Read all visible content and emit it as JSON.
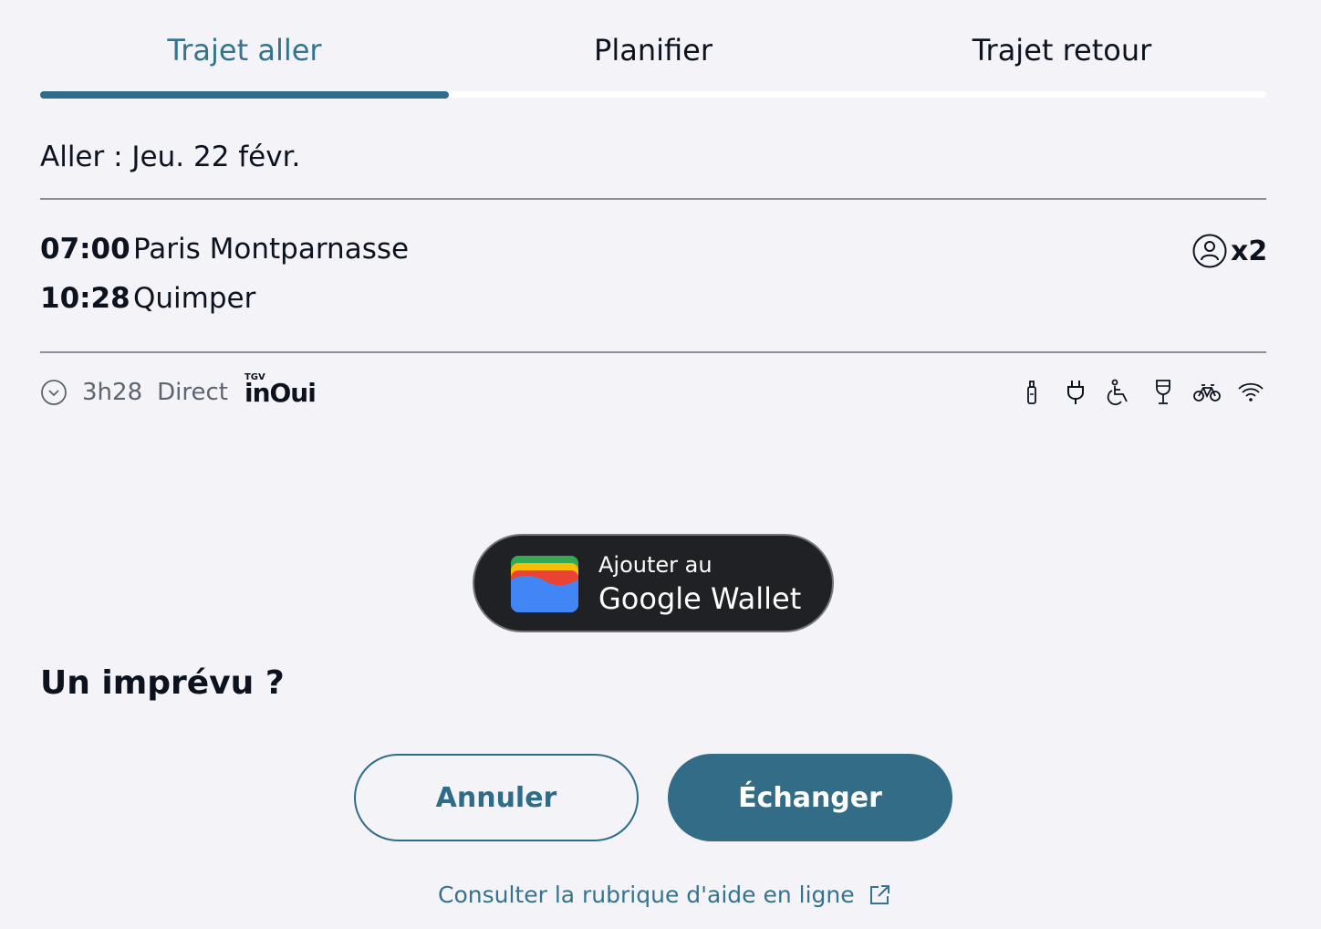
{
  "tabs": [
    {
      "label": "Trajet aller",
      "active": true
    },
    {
      "label": "Planifier",
      "active": false
    },
    {
      "label": "Trajet retour",
      "active": false
    }
  ],
  "outbound": {
    "date_label": "Aller : Jeu. 22 févr.",
    "departure": {
      "time": "07:00",
      "station": "Paris Montparnasse"
    },
    "arrival": {
      "time": "10:28",
      "station": "Quimper"
    },
    "passengers": "x2"
  },
  "trip_info": {
    "duration": "3h28",
    "type": "Direct",
    "brand_prefix": "TGV",
    "brand": "inOui",
    "icons": [
      "clock-icon",
      "bottle-icon",
      "plug-icon",
      "wheelchair-icon",
      "wine-glass-icon",
      "bicycle-icon",
      "wifi-icon"
    ]
  },
  "wallet_button": {
    "line1": "Ajouter au",
    "line2": "Google Wallet"
  },
  "unexpected": {
    "title": "Un imprévu ?",
    "cancel_label": "Annuler",
    "exchange_label": "Échanger",
    "help_link": "Consulter la rubrique d'aide en ligne"
  },
  "colors": {
    "accent": "#2f6c87",
    "background": "#f3f3f8",
    "text": "#0c131f",
    "muted": "#5d6570"
  }
}
